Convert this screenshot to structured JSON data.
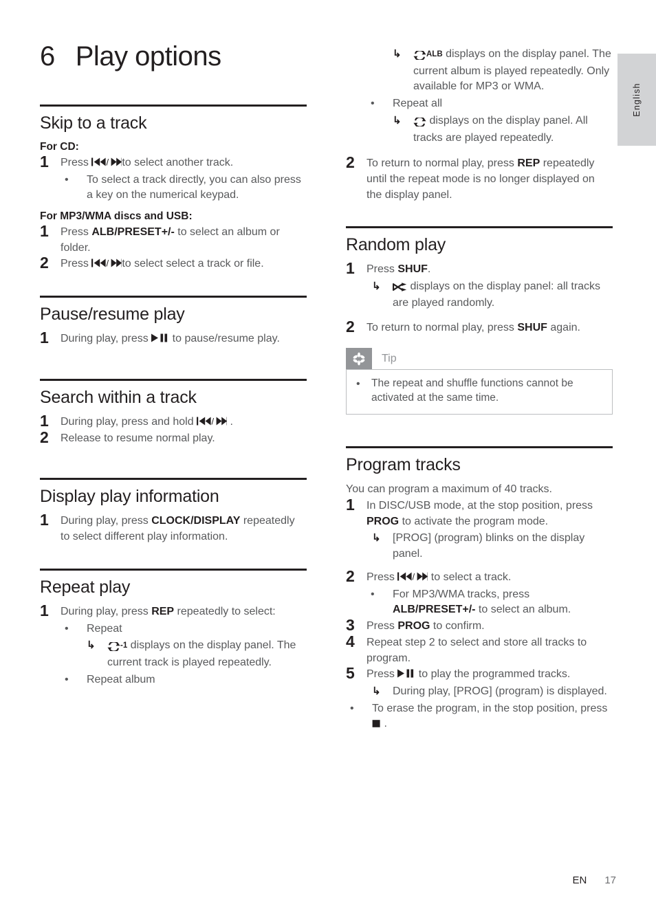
{
  "page": {
    "language_tab": "English",
    "footer": {
      "locale": "EN",
      "page_number": "17"
    }
  },
  "chapter": {
    "number": "6",
    "title": "Play options"
  },
  "icons": {
    "prev_next": "prev-next-track-icon",
    "play_pause": "play-pause-icon",
    "stop": "stop-icon",
    "repeat": "repeat-icon",
    "repeat_one_suffix": "-1",
    "repeat_album_suffix": "ALB",
    "shuffle": "shuffle-icon",
    "arrow": "↳",
    "bullet": "•",
    "tip": "asterisk-icon"
  },
  "sections": {
    "skip_to_track": {
      "title": "Skip to a track",
      "sub_cd": "For CD:",
      "step1_pre": "Press ",
      "step1_post": "to select another track.",
      "bullet1": "To select a track directly, you can also press a key on the numerical keypad.",
      "sub_mp3": "For MP3/WMA discs and USB:",
      "mp3_step1_pre": "Press ",
      "mp3_step1_key": "ALB/PRESET+/-",
      "mp3_step1_post": " to select an album or folder.",
      "mp3_step2_pre": "Press ",
      "mp3_step2_post": "to select select a track or file."
    },
    "pause_resume": {
      "title": "Pause/resume play",
      "step1_pre": "During play, press ",
      "step1_post": " to pause/resume play."
    },
    "search_within_track": {
      "title": "Search within a track",
      "step1_pre": "During play, press and hold ",
      "step1_post": " .",
      "step2": "Release to resume normal play."
    },
    "display_play_info": {
      "title": "Display play information",
      "step1_pre": "During play, press ",
      "step1_key": "CLOCK/DISPLAY",
      "step1_post": " repeatedly to select different play information."
    },
    "repeat_play": {
      "title": "Repeat play",
      "step1_pre": "During play, press ",
      "step1_key": "REP",
      "step1_post": " repeatedly to select:",
      "opt_repeat": "Repeat",
      "opt_repeat_detail": " displays on the display panel. The current track is played repeatedly.",
      "opt_repeat_album": "Repeat album",
      "opt_repeat_album_detail": " displays on the display panel. The current album is played repeatedly. Only available for MP3 or WMA.",
      "opt_repeat_all": "Repeat all",
      "opt_repeat_all_detail": " displays on the display panel. All tracks are played repeatedly.",
      "step2_pre": "To return to normal play, press ",
      "step2_key": "REP",
      "step2_post": " repeatedly until the repeat mode is no longer displayed on the display panel."
    },
    "random_play": {
      "title": "Random play",
      "step1_pre": "Press ",
      "step1_key": "SHUF",
      "step1_post": ".",
      "step1_detail": " displays on the display panel: all tracks are played randomly.",
      "step2_pre": "To return to normal play, press ",
      "step2_key": "SHUF",
      "step2_post": " again.",
      "tip_label": "Tip",
      "tip_text": "The repeat and shuffle functions cannot be activated at the same time."
    },
    "program_tracks": {
      "title": "Program tracks",
      "intro": "You can program a maximum of 40 tracks.",
      "step1_pre": "In DISC/USB mode, at the stop position, press ",
      "step1_key": "PROG",
      "step1_post": " to activate the program mode.",
      "step1_detail": "[PROG] (program) blinks on the display panel.",
      "step2_pre": "Press ",
      "step2_post": " to select a track.",
      "step2_bullet_pre": "For MP3/WMA tracks, press ",
      "step2_bullet_key": "ALB/PRESET+/-",
      "step2_bullet_post": " to select an album.",
      "step3_pre": "Press ",
      "step3_key": "PROG",
      "step3_post": " to confirm.",
      "step4": "Repeat step 2 to select and store all tracks to program.",
      "step5_pre": "Press ",
      "step5_post": " to play the programmed tracks.",
      "step5_detail": "During play, [PROG] (program) is displayed.",
      "erase_pre": "To erase the program, in the stop position, press ",
      "erase_post": " ."
    }
  },
  "numbers": {
    "one": "1",
    "two": "2",
    "three": "3",
    "four": "4",
    "five": "5"
  }
}
